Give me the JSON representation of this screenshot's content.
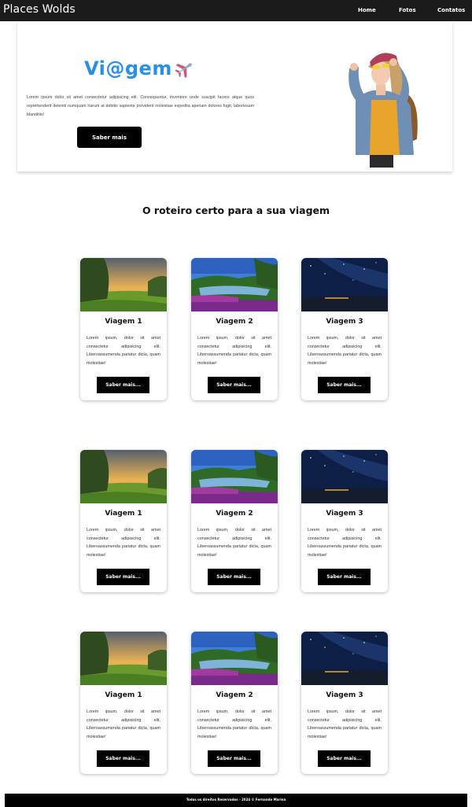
{
  "header": {
    "brand": "Places Wolds",
    "nav": [
      "Home",
      "Fotos",
      "Contatos"
    ]
  },
  "hero": {
    "title": "Vi@gem",
    "title_icon": "airplane-icon",
    "text": "Lorem ipsum dolor sit amet consectetur adipisicing elit. Consequuntur, inventore unde suscipit facere atque quos reprehenderit deleniti numquam harum at debitis sapiente provident molestiae expedita aperiam dolores fugit, laboriosam blanditiis!",
    "button": "Saber mais",
    "accent": "#2b8fe8"
  },
  "section": {
    "title": "O roteiro certo para a sua viagem"
  },
  "cards": [
    {
      "title": "Viagem 1",
      "image": "sunset-landscape",
      "text": "Lorem ipsum, dolor sit amet consectetur adipisicing elit. Liberoassumenda pariatur dicta, quam molestiae!",
      "button": "Saber mais..."
    },
    {
      "title": "Viagem 2",
      "image": "garden-lake",
      "text": "Lorem ipsum, dolor sit amet consectetur adipisicing elit. Liberoassumenda pariatur dicta, quam molestiae!",
      "button": "Saber mais..."
    },
    {
      "title": "Viagem 3",
      "image": "night-sky",
      "text": "Lorem ipsum, dolor sit amet consectetur adipisicing elit. Liberoassumenda pariatur dicta, quam molestiae!",
      "button": "Saber mais..."
    }
  ],
  "footer": {
    "text": "Todos os direitos Reservados - 2024 © Fernando Marina"
  }
}
